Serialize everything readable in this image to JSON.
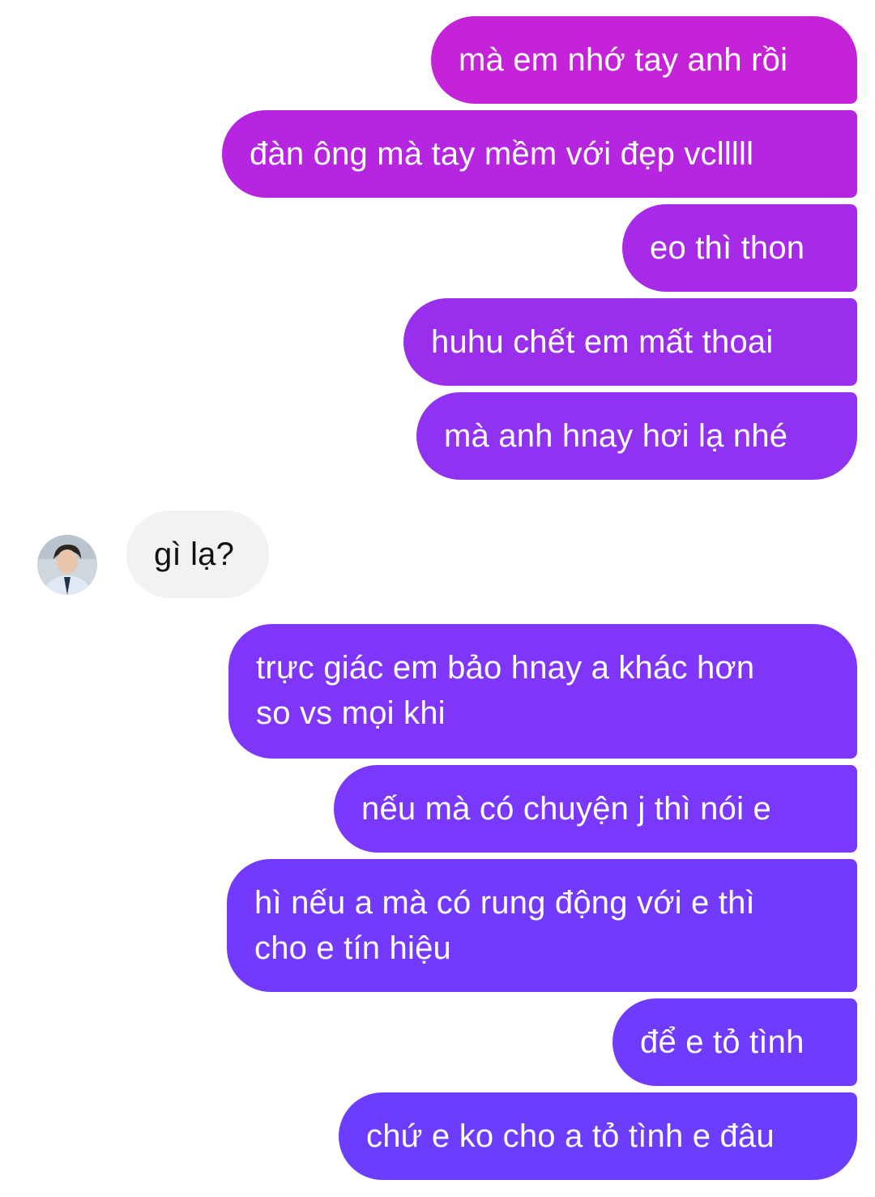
{
  "messages": [
    {
      "id": "m1",
      "side": "outgoing",
      "text": "mà em nhớ tay anh rồi"
    },
    {
      "id": "m2",
      "side": "outgoing",
      "text": "đàn ông mà tay mềm với đẹp vclllll"
    },
    {
      "id": "m3",
      "side": "outgoing",
      "text": "eo thì thon"
    },
    {
      "id": "m4",
      "side": "outgoing",
      "text": "huhu chết em mất thoai"
    },
    {
      "id": "m5",
      "side": "outgoing",
      "text": "mà anh hnay hơi lạ nhé"
    },
    {
      "id": "m6",
      "side": "incoming",
      "text": "gì lạ?"
    },
    {
      "id": "m7",
      "side": "outgoing",
      "text": "trực giác em bảo hnay a khác hơn\nso vs mọi khi"
    },
    {
      "id": "m8",
      "side": "outgoing",
      "text": "nếu mà có chuyện j thì nói e"
    },
    {
      "id": "m9",
      "side": "outgoing",
      "text": "hì nếu a mà có rung động với e thì\ncho e tín hiệu"
    },
    {
      "id": "m10",
      "side": "outgoing",
      "text": "để e tỏ tình"
    },
    {
      "id": "m11",
      "side": "outgoing",
      "text": "chứ e ko cho a tỏ tình e đâu"
    }
  ],
  "colors": {
    "outgoing_gradient_top": "#c523d6",
    "outgoing_gradient_bottom": "#6a3cff",
    "incoming_bubble": "#f1f2f4",
    "background": "#ffffff"
  },
  "avatar": {
    "icon": "user-avatar-photo"
  }
}
